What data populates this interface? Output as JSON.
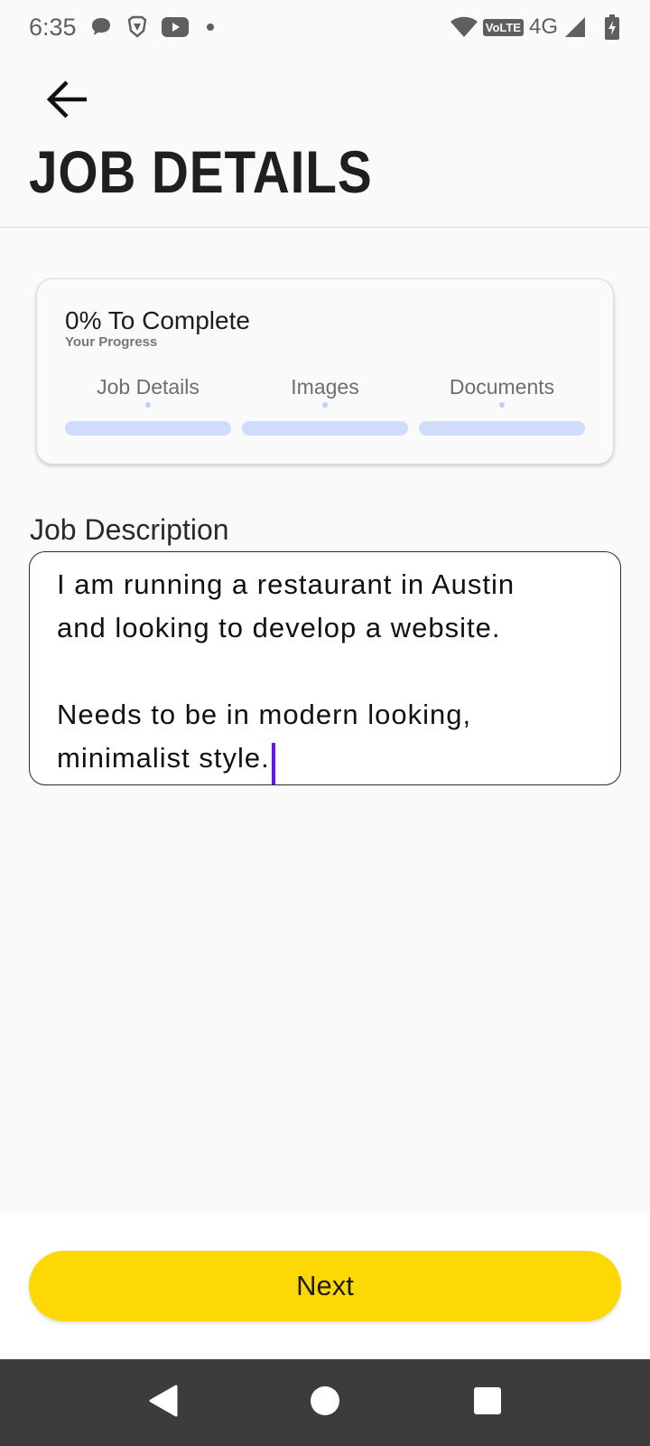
{
  "status_bar": {
    "time": "6:35",
    "left_icons": [
      "chat-bubble-icon",
      "brave-lion-icon",
      "youtube-icon",
      "dot-icon"
    ],
    "network_label": "4G",
    "volte_label": "VoLTE",
    "right_icons": [
      "wifi-icon",
      "volte-icon",
      "signal-icon",
      "battery-charging-icon"
    ]
  },
  "header": {
    "back_icon": "arrow-left-icon",
    "title": "JOB DETAILS"
  },
  "progress": {
    "title": "0% To Complete",
    "subtitle": "Your Progress",
    "percent": 0,
    "steps": [
      {
        "label": "Job Details",
        "complete": 0
      },
      {
        "label": "Images",
        "complete": 0
      },
      {
        "label": "Documents",
        "complete": 0
      }
    ],
    "bar_color": "#cfdcfb"
  },
  "job_description": {
    "label": "Job Description",
    "value": "I am running a restaurant in Austin\nand looking to develop a website.\n\nNeeds to be in modern looking,\nminimalist style."
  },
  "footer": {
    "next_label": "Next",
    "accent_color": "#fcd804"
  },
  "nav_bar": {
    "icons": [
      "back-triangle-icon",
      "home-circle-icon",
      "recents-square-icon"
    ]
  }
}
